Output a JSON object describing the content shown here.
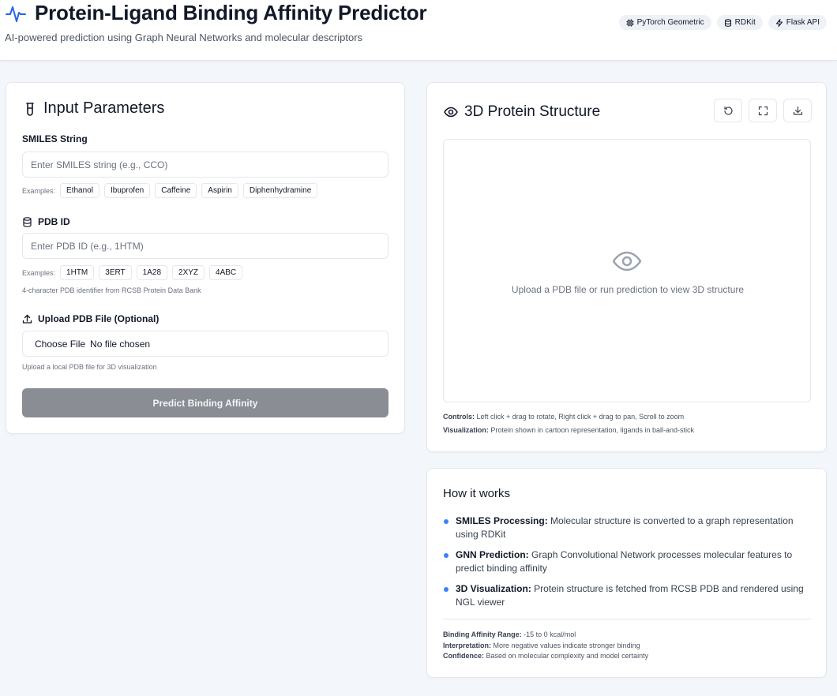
{
  "header": {
    "title": "Protein-Ligand Binding Affinity Predictor",
    "subtitle": "AI-powered prediction using Graph Neural Networks and molecular descriptors",
    "badges": [
      {
        "icon": "cpu-icon",
        "label": "PyTorch Geometric"
      },
      {
        "icon": "database-icon",
        "label": "RDKit"
      },
      {
        "icon": "lightning-icon",
        "label": "Flask API"
      }
    ],
    "accent_color": "#2563eb"
  },
  "input_panel": {
    "title": "Input Parameters",
    "smiles": {
      "label": "SMILES String",
      "value": "",
      "placeholder": "Enter SMILES string (e.g., CCO)",
      "examples_label": "Examples:",
      "examples": [
        "Ethanol",
        "Ibuprofen",
        "Caffeine",
        "Aspirin",
        "Diphenhydramine"
      ]
    },
    "pdb": {
      "label": "PDB ID",
      "value": "",
      "placeholder": "Enter PDB ID (e.g., 1HTM)",
      "examples_label": "Examples:",
      "examples": [
        "1HTM",
        "3ERT",
        "1A28",
        "2XYZ",
        "4ABC"
      ],
      "hint": "4-character PDB identifier from RCSB Protein Data Bank"
    },
    "upload": {
      "label": "Upload PDB File (Optional)",
      "button": "Choose File",
      "status": "No file chosen",
      "hint": "Upload a local PDB file for 3D visualization"
    },
    "predict_button": "Predict Binding Affinity",
    "predict_button_color": "#8a8d94"
  },
  "viewer": {
    "title": "3D Protein Structure",
    "tools": [
      "reset-icon",
      "fullscreen-icon",
      "download-icon"
    ],
    "empty_message": "Upload a PDB file or run prediction to view 3D structure",
    "controls_label": "Controls:",
    "controls_text": "Left click + drag to rotate, Right click + drag to pan, Scroll to zoom",
    "visualization_label": "Visualization:",
    "visualization_text": "Protein shown in cartoon representation, ligands in ball-and-stick"
  },
  "how_it_works": {
    "title": "How it works",
    "items": [
      {
        "title": "SMILES Processing:",
        "text": "Molecular structure is converted to a graph representation using RDKit"
      },
      {
        "title": "GNN Prediction:",
        "text": "Graph Convolutional Network processes molecular features to predict binding affinity"
      },
      {
        "title": "3D Visualization:",
        "text": "Protein structure is fetched from RCSB PDB and rendered using NGL viewer"
      }
    ],
    "range_label": "Binding Affinity Range:",
    "range_text": "-15 to 0 kcal/mol",
    "interpretation_label": "Interpretation:",
    "interpretation_text": "More negative values indicate stronger binding",
    "confidence_label": "Confidence:",
    "confidence_text": "Based on molecular complexity and model certainty"
  }
}
